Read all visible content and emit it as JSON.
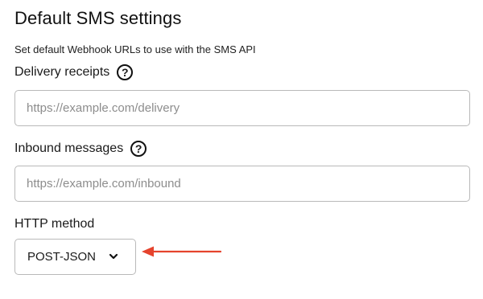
{
  "section": {
    "title": "Default SMS settings",
    "subtitle": "Set default Webhook URLs to use with the SMS API"
  },
  "delivery": {
    "label": "Delivery receipts",
    "help_icon": "?",
    "value": "",
    "placeholder": "https://example.com/delivery"
  },
  "inbound": {
    "label": "Inbound messages",
    "help_icon": "?",
    "value": "",
    "placeholder": "https://example.com/inbound"
  },
  "http_method": {
    "label": "HTTP method",
    "selected": "POST-JSON",
    "icon": "chevron-down-icon"
  },
  "annotation": {
    "icon": "arrow-left-icon",
    "color": "#e5432d"
  }
}
